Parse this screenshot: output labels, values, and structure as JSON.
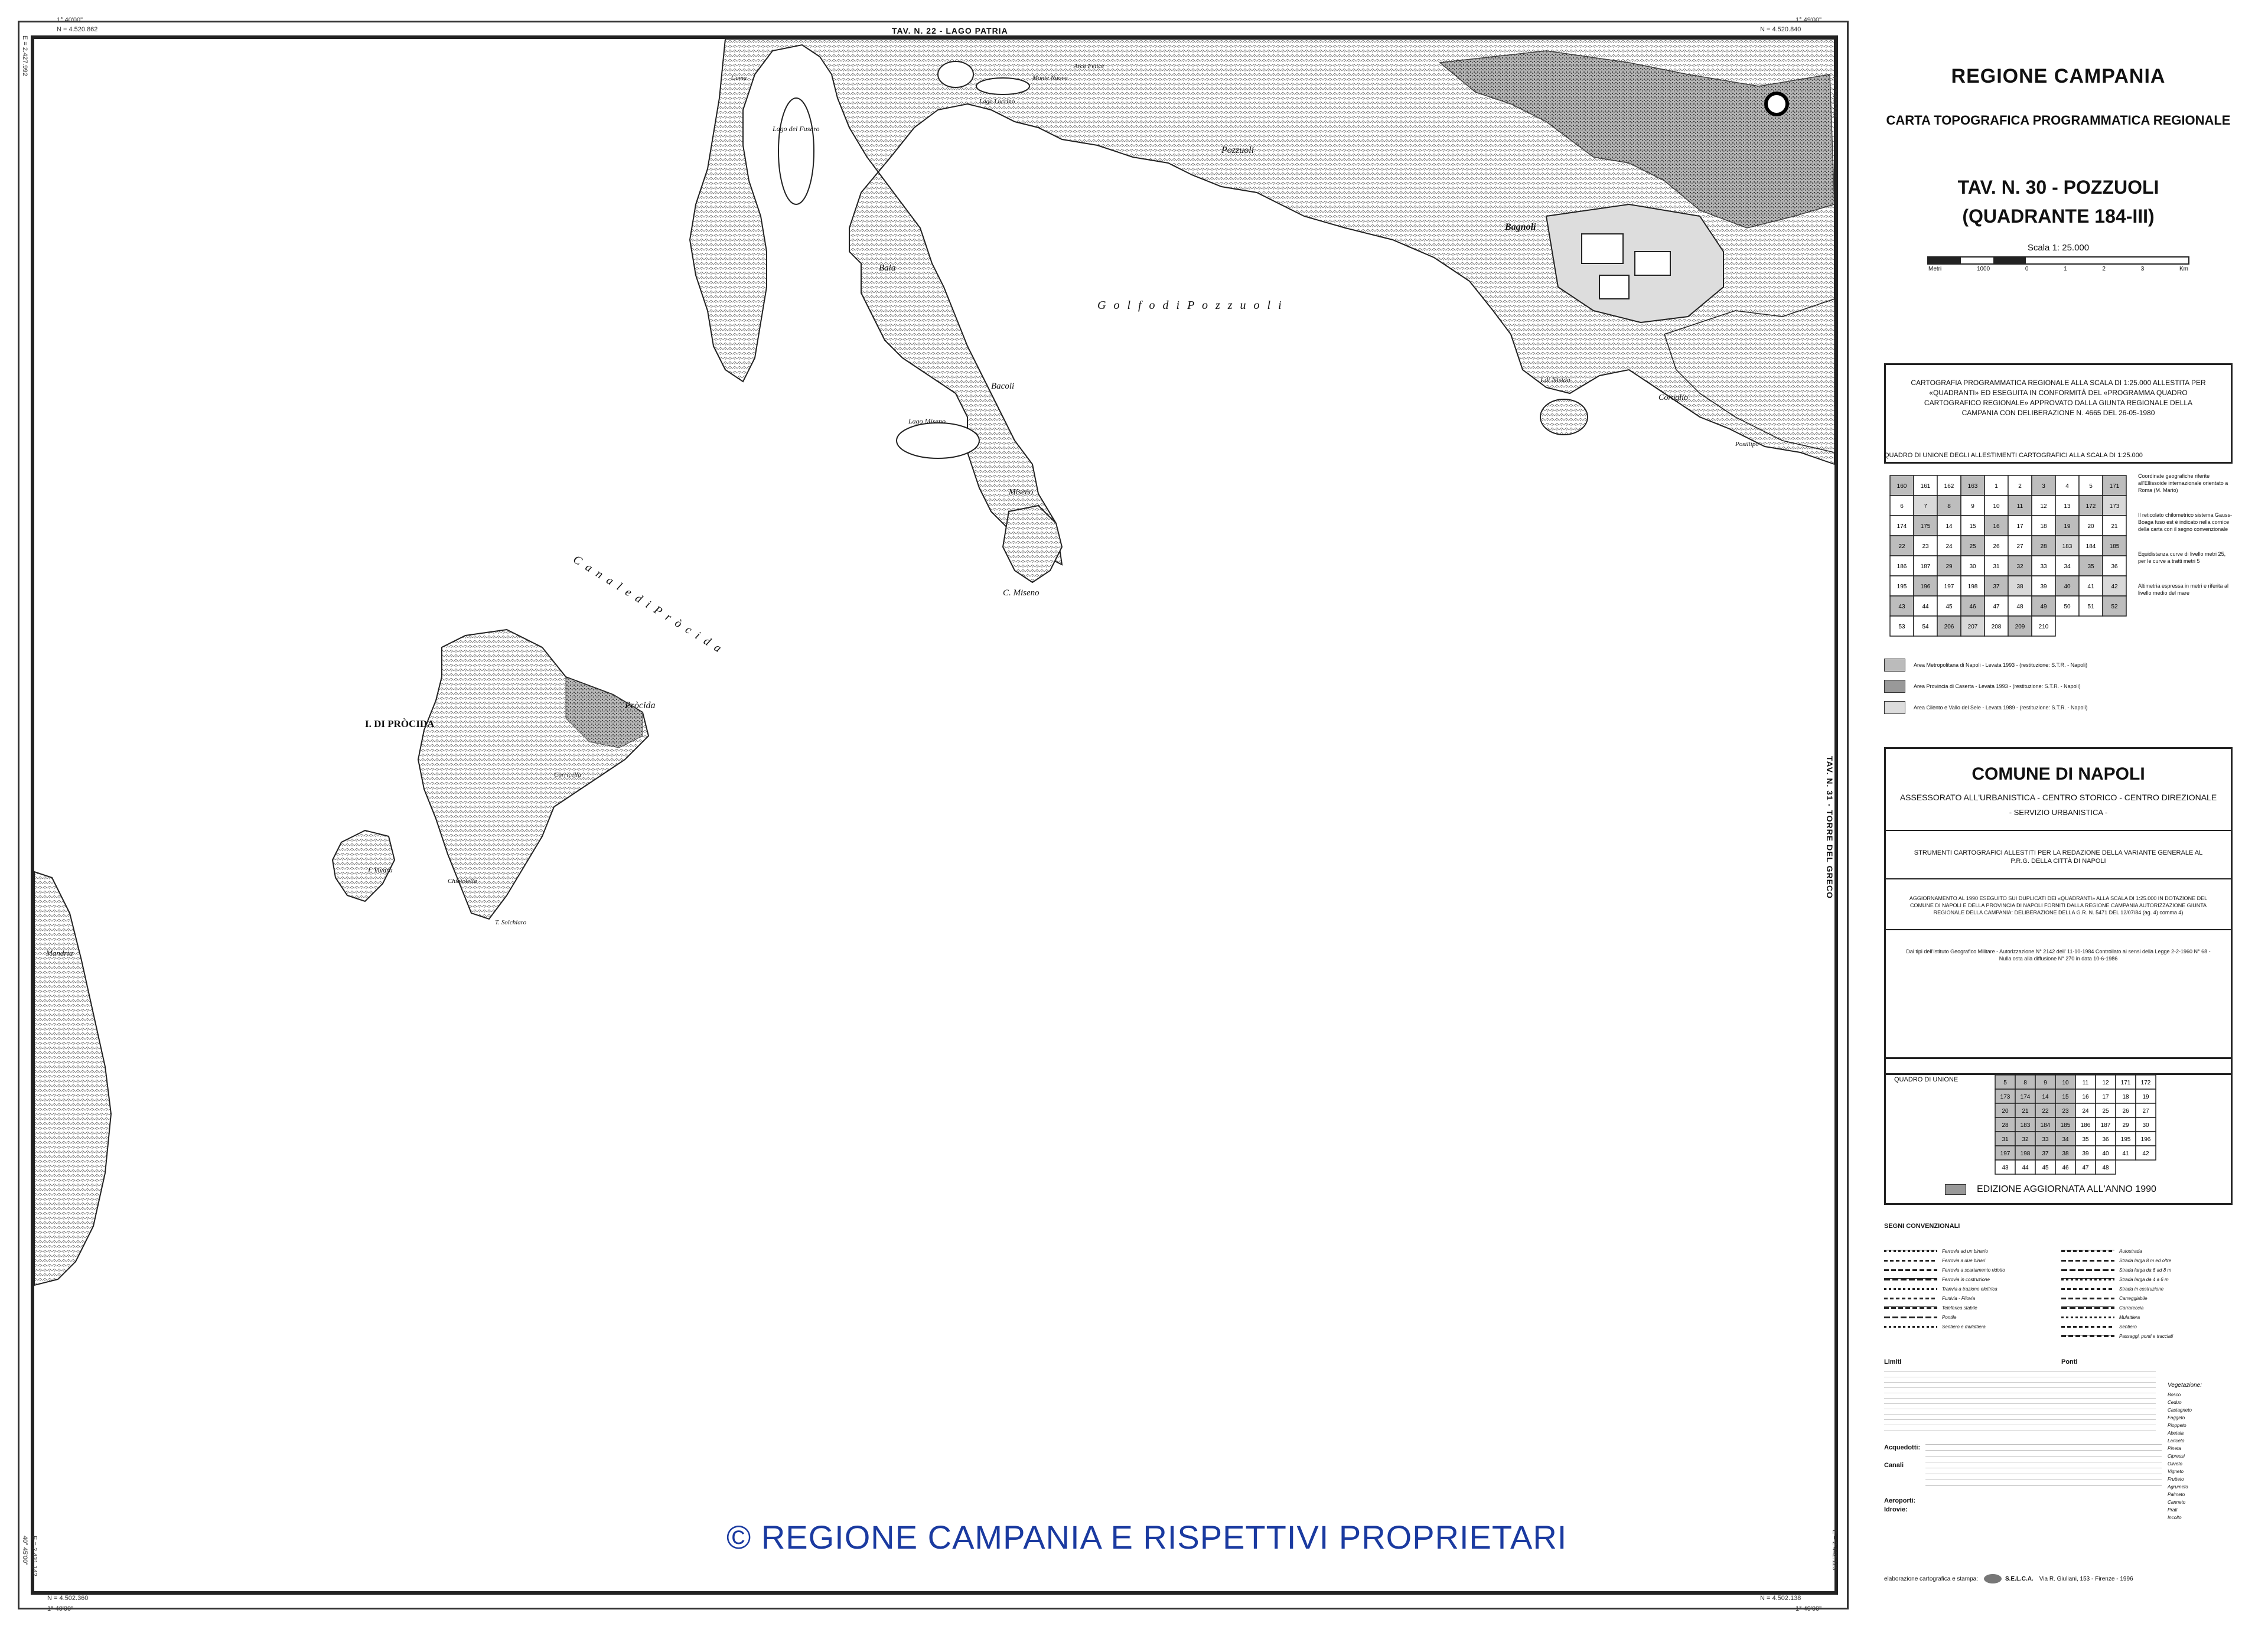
{
  "map": {
    "top_label": "TAV. N. 22 - LAGO PATRIA",
    "right_label": "TAV. N. 31 - TORRE DEL GRECO",
    "coords": {
      "top_left_n": "N = 4.520.862",
      "top_left_e": "E = 2.427.992",
      "top_left_deg": "1° 40'00\"",
      "top_right_n": "N = 4.520.840",
      "top_right_deg": "1° 49'00\"",
      "top_right_e": "E = 2.442.143",
      "bottom_left_n": "N = 4.502.360",
      "bottom_left_e": "E = 2.431.142",
      "bottom_left_deg": "40° 45'00\"",
      "bottom_left_deg2": "1° 40'00\"",
      "bottom_right_n": "N = 4.502.138",
      "bottom_right_deg": "1° 49'00\"",
      "bottom_right_e": "E = 2.442.129"
    },
    "place_names": {
      "golfo": "G o l f o   d i   P o z z u o l i",
      "canale": "C a n a l e   d i   P r ò c i d a",
      "procida_island": "I. DI PRÒCIDA",
      "procida_town": "Pròcida",
      "pozzuoli": "Pozzuoli",
      "bagnoli": "Bagnoli",
      "baia": "Baia",
      "bacoli": "Bacoli",
      "lago_miseno": "Lago Miseno",
      "miseno": "Miseno",
      "c_miseno": "C. Miseno",
      "lago_fusaro": "Lago del Fusaro",
      "nisida": "I.di Nisida",
      "coroglio": "Coroglio",
      "lucrino": "Lago Lucrino",
      "arco_felice": "Arco Felice",
      "solchiaro": "T. Solchiaro",
      "chiaiolella": "Chiaiolella",
      "vivara": "I. Vivara",
      "corricella": "Corricella",
      "monte_nuovo": "Monte Nuovo",
      "posillipo": "Posillipo",
      "mandria": "Mandria",
      "cuma": "Cuma"
    },
    "copyright": "© REGIONE CAMPANIA E RISPETTIVI PROPRIETARI"
  },
  "panel": {
    "region": "REGIONE CAMPANIA",
    "carta": "CARTA TOPOGRAFICA PROGRAMMATICA REGIONALE",
    "tav": "TAV. N. 30 - POZZUOLI",
    "quadrante": "(QUADRANTE 184-III)",
    "scala": "Scala  1: 25.000",
    "scale_ticks": [
      "Metri",
      "1000",
      "0",
      "1",
      "2",
      "3",
      "Km"
    ],
    "cartografia_text": "CARTOGRAFIA PROGRAMMATICA REGIONALE ALLA SCALA DI 1:25.000 ALLESTITA PER «QUADRANTI» ED ESEGUITA IN CONFORMITÀ DEL «PROGRAMMA QUADRO CARTOGRAFICO REGIONALE» APPROVATO DALLA GIUNTA REGIONALE DELLA CAMPANIA CON DELIBERAZIONE N. 4665 DEL 26-05-1980",
    "quadro_title": "QUADRO DI UNIONE DEGLI ALLESTIMENTI CARTOGRAFICI ALLA SCALA DI 1:25.000",
    "quadro_notes": [
      "Coordinate geografiche riferite all'Ellissoide internazionale orientato a Roma (M. Mario)",
      "Il reticolato chilometrico sistema Gauss-Boaga fuso est è indicato nella cornice della carta con il segno convenzionale",
      "Equidistanza curve di livello metri 25, per le curve a tratti metri 5",
      "Altimetria espressa in metri e riferita al livello medio del mare"
    ],
    "grid_numbers": [
      "160",
      "161",
      "162",
      "163",
      "1",
      "2",
      "3",
      "4",
      "5",
      "171",
      "6",
      "7",
      "8",
      "9",
      "10",
      "11",
      "12",
      "13",
      "172",
      "173",
      "174",
      "175",
      "14",
      "15",
      "16",
      "17",
      "18",
      "19",
      "20",
      "21",
      "22",
      "23",
      "24",
      "25",
      "26",
      "27",
      "28",
      "183",
      "184",
      "185",
      "186",
      "187",
      "29",
      "30",
      "31",
      "32",
      "33",
      "34",
      "35",
      "36",
      "195",
      "196",
      "197",
      "198",
      "37",
      "38",
      "39",
      "40",
      "41",
      "42",
      "43",
      "44",
      "45",
      "46",
      "47",
      "48",
      "49",
      "50",
      "51",
      "52",
      "53",
      "54",
      "206",
      "207",
      "208",
      "209",
      "210"
    ],
    "area_legend": [
      "Area Metropolitana di Napoli  - Levata 1993 - (restituzione: S.T.R. - Napoli)",
      "Area Provincia di Caserta  - Levata 1993 - (restituzione: S.T.R. - Napoli)",
      "Area Cilento e Vallo del Sele  - Levata 1989 - (restituzione: S.T.R. - Napoli)"
    ],
    "comune": "COMUNE DI NAPOLI",
    "assessorato": "ASSESSORATO ALL'URBANISTICA - CENTRO STORICO - CENTRO DIREZIONALE",
    "servizio": "- SERVIZIO URBANISTICA -",
    "strumenti": "STRUMENTI CARTOGRAFICI ALLESTITI PER LA REDAZIONE DELLA VARIANTE GENERALE AL P.R.G. DELLA CITTÀ DI NAPOLI",
    "aggiornamento": "AGGIORNAMENTO AL 1990 ESEGUITO SUI DUPLICATI DEI «QUADRANTI» ALLA SCALA DI 1:25.000 IN DOTAZIONE DEL COMUNE DI NAPOLI E DELLA PROVINCIA DI NAPOLI FORNITI DALLA REGIONE CAMPANIA AUTORIZZAZIONE GIUNTA REGIONALE DELLA CAMPANIA: DELIBERAZIONE DELLA G.R. N. 5471 DEL 12/07/84 (ag. 4) comma 4)",
    "dati": "Dai tipi dell'Istituto Geografico Militare - Autorizzazione N° 2142 dell' 11-10-1984 Controllato ai sensi della Legge 2-2-1960 N° 68 - Nulla osta alla diffusione N° 270 in data 10-6-1986",
    "quadro_unione": "QUADRO DI UNIONE",
    "edizione": "EDIZIONE  AGGIORNATA  ALL'ANNO  1990",
    "unione_numbers": [
      "5",
      "8",
      "9",
      "10",
      "11",
      "12",
      "171",
      "172",
      "173",
      "174",
      "14",
      "15",
      "16",
      "17",
      "18",
      "19",
      "20",
      "21",
      "22",
      "23",
      "24",
      "25",
      "26",
      "27",
      "28",
      "183",
      "184",
      "185",
      "186",
      "187",
      "29",
      "30",
      "31",
      "32",
      "33",
      "34",
      "35",
      "36",
      "195",
      "196",
      "197",
      "198",
      "37",
      "38",
      "39",
      "40",
      "41",
      "42",
      "43",
      "44",
      "45",
      "46",
      "47",
      "48"
    ],
    "segni": "SEGNI CONVENZIONALI",
    "segni_items": [
      "Ferrovia ad un binario",
      "Ferrovia a due binari",
      "Ferrovia a scartamento ridotto",
      "Ferrovia in costruzione",
      "Tranvia a trazione elettrica",
      "Funivia - Filovia",
      "Teleferica stabile",
      "Pontile",
      "Sentiero e mulattiera",
      "Autostrada",
      "Strada larga 8 m ed oltre",
      "Strada larga da 6 ad 8 m",
      "Strada larga da 4 a 6 m",
      "Strada in costruzione",
      "Carreggiabile",
      "Carrareccia",
      "Mulattiera",
      "Sentiero",
      "Passaggi, ponti e tracciati"
    ],
    "limiti": "Limiti",
    "ponti": "Ponti",
    "vegetazione": "Vegetazione:",
    "veg_items": [
      "Bosco",
      "Ceduo",
      "Castagneto",
      "Faggeto",
      "Pioppeto",
      "Abetaia",
      "Lariceto",
      "Pineta",
      "Cipressi",
      "Oliveto",
      "Vigneto",
      "Frutteto",
      "Agrumeto",
      "Palmeto",
      "Canneto",
      "Prati",
      "Incolto"
    ],
    "acquedotti": "Acquedotti:",
    "canali": "Canali",
    "aeroporti": "Aeroporti:",
    "idrovie": "Idrovie:",
    "elaborazione": "elaborazione cartografica e stampa:",
    "selca": "S.E.L.C.A.",
    "selca_addr": "Via R. Giuliani, 153 - Firenze - 1996"
  }
}
